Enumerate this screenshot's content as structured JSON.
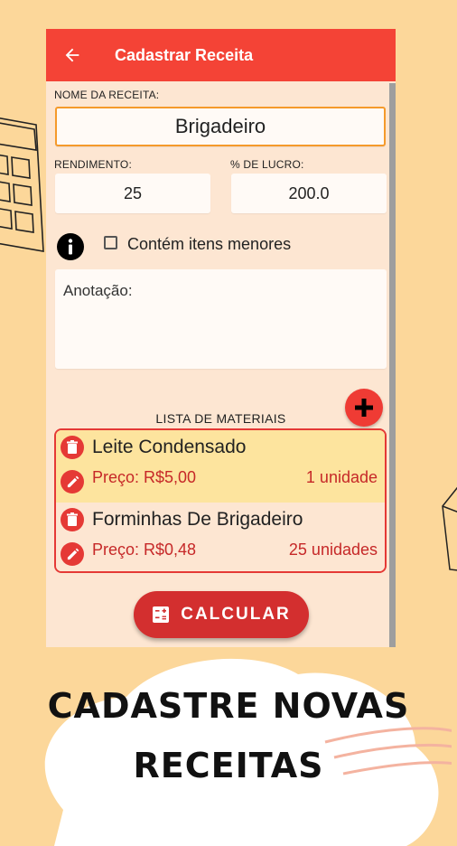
{
  "colors": {
    "background": "#fcd79a",
    "app_bar": "#f44336",
    "screen_bg": "#fde6d2",
    "accent_red": "#e53935",
    "highlight_row": "#fde49e",
    "name_border": "#f59a2b"
  },
  "app_bar": {
    "title": "Cadastrar Receita",
    "back_icon": "arrow-left-icon"
  },
  "form": {
    "name_label": "NOME DA RECEITA:",
    "name_value": "Brigadeiro",
    "yield_label": "RENDIMENTO:",
    "yield_value": "25",
    "profit_label": "% DE LUCRO:",
    "profit_value": "200.0",
    "info_icon": "info-icon",
    "checkbox_label": "Contém itens menores",
    "checkbox_checked": false,
    "notes_placeholder": "Anotação:"
  },
  "materials": {
    "title": "LISTA DE MATERIAIS",
    "add_icon": "plus-icon",
    "items": [
      {
        "name": "Leite Condensado",
        "price": "Preço: R$5,00",
        "quantity": "1 unidade"
      },
      {
        "name": "Forminhas De Brigadeiro",
        "price": "Preço: R$0,48",
        "quantity": "25 unidades"
      }
    ]
  },
  "calculate_button": {
    "label": "CALCULAR",
    "icon": "calculator-icon"
  },
  "promo": {
    "line1": "CADASTRE NOVAS",
    "line2": "RECEITAS"
  }
}
